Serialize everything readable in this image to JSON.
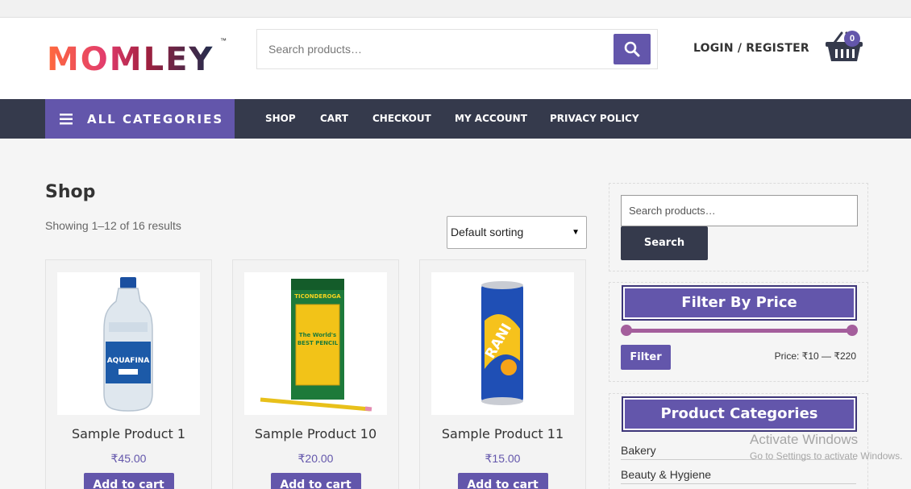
{
  "header": {
    "logo_text": "MOMLEY",
    "logo_tm": "™",
    "search_placeholder": "Search products…",
    "login_label": "LOGIN / REGISTER",
    "cart_count": "0"
  },
  "nav": {
    "all_categories_label": "ALL CATEGORIES",
    "items": [
      {
        "label": "SHOP"
      },
      {
        "label": "CART"
      },
      {
        "label": "CHECKOUT"
      },
      {
        "label": "MY ACCOUNT"
      },
      {
        "label": "PRIVACY POLICY"
      }
    ]
  },
  "shop": {
    "title": "Shop",
    "result_count": "Showing 1–12 of 16 results",
    "sorting_value": "Default sorting"
  },
  "products": [
    {
      "name": "Sample Product 1",
      "price": "₹45.00",
      "button": "Add to cart",
      "image": "water-bottle"
    },
    {
      "name": "Sample Product 10",
      "price": "₹20.00",
      "button": "Add to cart",
      "image": "pencil-box"
    },
    {
      "name": "Sample Product 11",
      "price": "₹15.00",
      "button": "Add to cart",
      "image": "drink-can"
    }
  ],
  "sidebar": {
    "search_placeholder": "Search products…",
    "search_button": "Search",
    "price_heading": "Filter By Price",
    "filter_button": "Filter",
    "price_range": "Price: ₹10 — ₹220",
    "price_min_fraction": 0,
    "price_max_fraction": 1,
    "categories_heading": "Product Categories",
    "categories": [
      "Bakery",
      "Beauty & Hygiene"
    ]
  },
  "overlay": {
    "title": "Activate Windows",
    "subtitle": "Go to Settings to activate Windows."
  },
  "colors": {
    "primary": "#6356ab",
    "nav_bg": "#353a4c",
    "slider": "#a45e9c"
  }
}
